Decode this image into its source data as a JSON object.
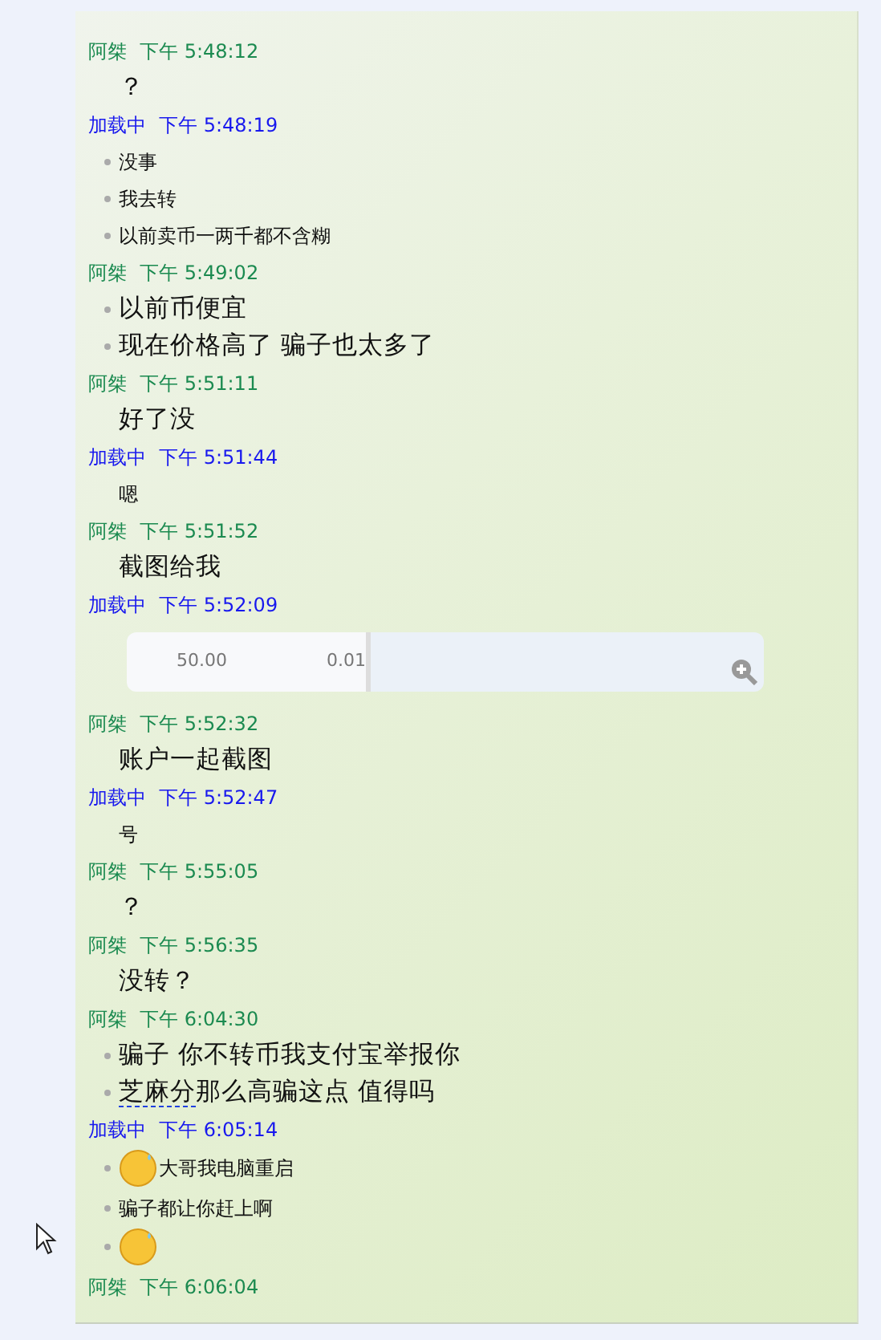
{
  "messages": [
    {
      "sender": "阿桀",
      "color": "#1b8a50",
      "time": "下午 5:48:12",
      "lines": [
        {
          "text": "？",
          "kind": "large",
          "bullet": false
        }
      ]
    },
    {
      "sender": "加载中",
      "color": "#1818ee",
      "time": "下午 5:48:19",
      "lines": [
        {
          "text": "没事",
          "kind": "small",
          "bullet": true
        },
        {
          "text": "我去转",
          "kind": "small",
          "bullet": true
        },
        {
          "text": "以前卖币一两千都不含糊",
          "kind": "small",
          "bullet": true
        }
      ]
    },
    {
      "sender": "阿桀",
      "color": "#1b8a50",
      "time": "下午 5:49:02",
      "lines": [
        {
          "text": "以前币便宜",
          "kind": "large",
          "bullet": true
        },
        {
          "text": "现在价格高了  骗子也太多了",
          "kind": "large",
          "bullet": true
        }
      ]
    },
    {
      "sender": "阿桀",
      "color": "#1b8a50",
      "time": "下午 5:51:11",
      "lines": [
        {
          "text": "好了没",
          "kind": "large",
          "bullet": false
        }
      ]
    },
    {
      "sender": "加载中",
      "color": "#1818ee",
      "time": "下午 5:51:44",
      "lines": [
        {
          "text": "嗯",
          "kind": "small",
          "bullet": false
        }
      ]
    },
    {
      "sender": "阿桀",
      "color": "#1b8a50",
      "time": "下午 5:51:52",
      "lines": [
        {
          "text": "截图给我",
          "kind": "large",
          "bullet": false
        }
      ]
    },
    {
      "sender": "加载中",
      "color": "#1818ee",
      "time": "下午 5:52:09",
      "image": {
        "amount": "50.00",
        "fee": "0.01"
      }
    },
    {
      "sender": "阿桀",
      "color": "#1b8a50",
      "time": "下午 5:52:32",
      "lines": [
        {
          "text": "账户一起截图",
          "kind": "large",
          "bullet": false
        }
      ]
    },
    {
      "sender": "加载中",
      "color": "#1818ee",
      "time": "下午 5:52:47",
      "lines": [
        {
          "text": "号",
          "kind": "small",
          "bullet": false
        }
      ]
    },
    {
      "sender": "阿桀",
      "color": "#1b8a50",
      "time": "下午 5:55:05",
      "lines": [
        {
          "text": "？",
          "kind": "large",
          "bullet": false
        }
      ]
    },
    {
      "sender": "阿桀",
      "color": "#1b8a50",
      "time": "下午 5:56:35",
      "lines": [
        {
          "text": "没转？",
          "kind": "large",
          "bullet": false
        }
      ]
    },
    {
      "sender": "阿桀",
      "color": "#1b8a50",
      "time": "下午 6:04:30",
      "lines": [
        {
          "text": "骗子  你不转币我支付宝举报你",
          "kind": "large",
          "bullet": true
        },
        {
          "marked": "芝麻分",
          "text": "那么高骗这点  值得吗",
          "kind": "large",
          "bullet": true
        }
      ]
    },
    {
      "sender": "加载中",
      "color": "#1818ee",
      "time": "下午 6:05:14",
      "lines": [
        {
          "text": "大哥我电脑重启",
          "kind": "emoji",
          "bullet": true
        },
        {
          "text": "骗子都让你赶上啊",
          "kind": "small",
          "bullet": true
        },
        {
          "kind": "emoji",
          "bullet": true
        }
      ]
    },
    {
      "sender": "阿桀",
      "color": "#1b8a50",
      "time": "下午 6:06:04"
    }
  ]
}
